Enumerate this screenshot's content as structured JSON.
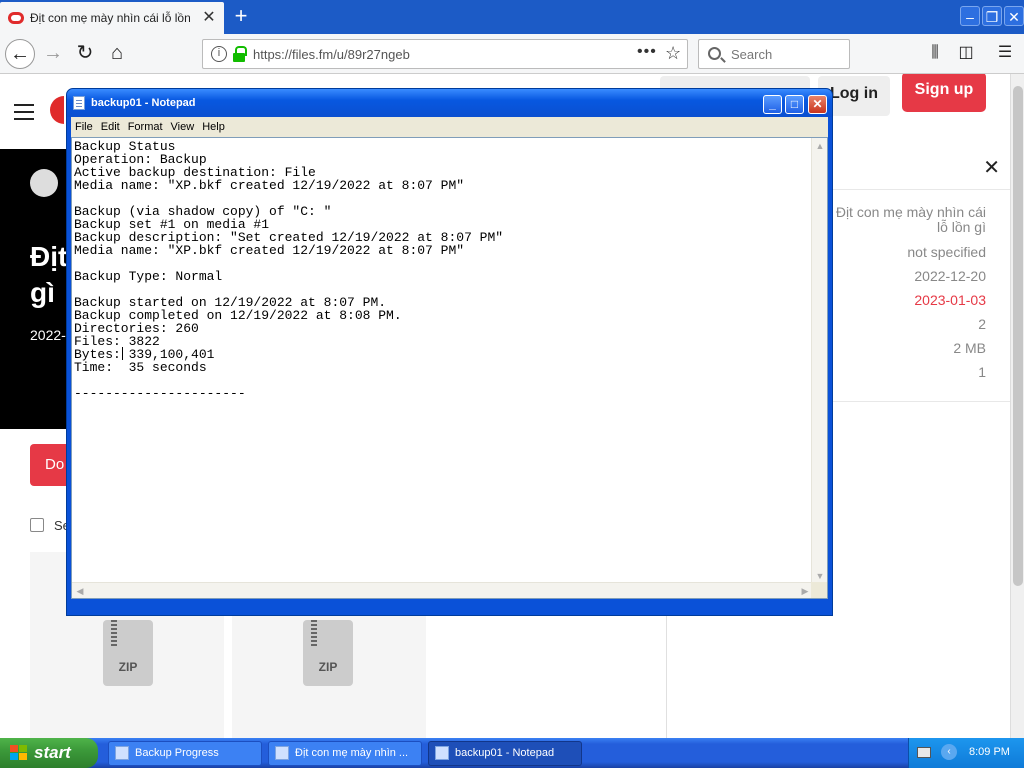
{
  "browser": {
    "tab_title": "Địt con mẹ mày nhìn cái lỗ lồn gì l",
    "url": "https://files.fm/u/89r27ngeb",
    "search_placeholder": "Search"
  },
  "site": {
    "login_label": "Log in",
    "signup_label": "Sign up",
    "hero_title": "Địt gì",
    "hero_date": "2022-",
    "download_label": "Do",
    "select_label": "Se",
    "zip_label": "ZIP",
    "side_panel": {
      "name": "Địt con mẹ mày nhìn cái lỗ lồn gì",
      "description": "not specified",
      "created": "2022-12-20",
      "expires": "2023-01-03",
      "files_count": "2",
      "size": "2 MB",
      "downloads": "1"
    }
  },
  "notepad": {
    "title": "backup01 - Notepad",
    "menu": [
      "File",
      "Edit",
      "Format",
      "View",
      "Help"
    ],
    "content": "Backup Status\nOperation: Backup\nActive backup destination: File\nMedia name: \"XP.bkf created 12/19/2022 at 8:07 PM\"\n\nBackup (via shadow copy) of \"C: \"\nBackup set #1 on media #1\nBackup description: \"Set created 12/19/2022 at 8:07 PM\"\nMedia name: \"XP.bkf created 12/19/2022 at 8:07 PM\"\n\nBackup Type: Normal\n\nBackup started on 12/19/2022 at 8:07 PM.\nBackup completed on 12/19/2022 at 8:08 PM.\nDirectories: 260\nFiles: 3822\nBytes: 339,100,401\nTime:  35 seconds\n\n----------------------"
  },
  "taskbar": {
    "start_label": "start",
    "buttons": [
      {
        "label": "Backup Progress"
      },
      {
        "label": "Địt con mẹ mày nhìn ..."
      },
      {
        "label": "backup01 - Notepad"
      }
    ],
    "clock": "8:09 PM"
  }
}
